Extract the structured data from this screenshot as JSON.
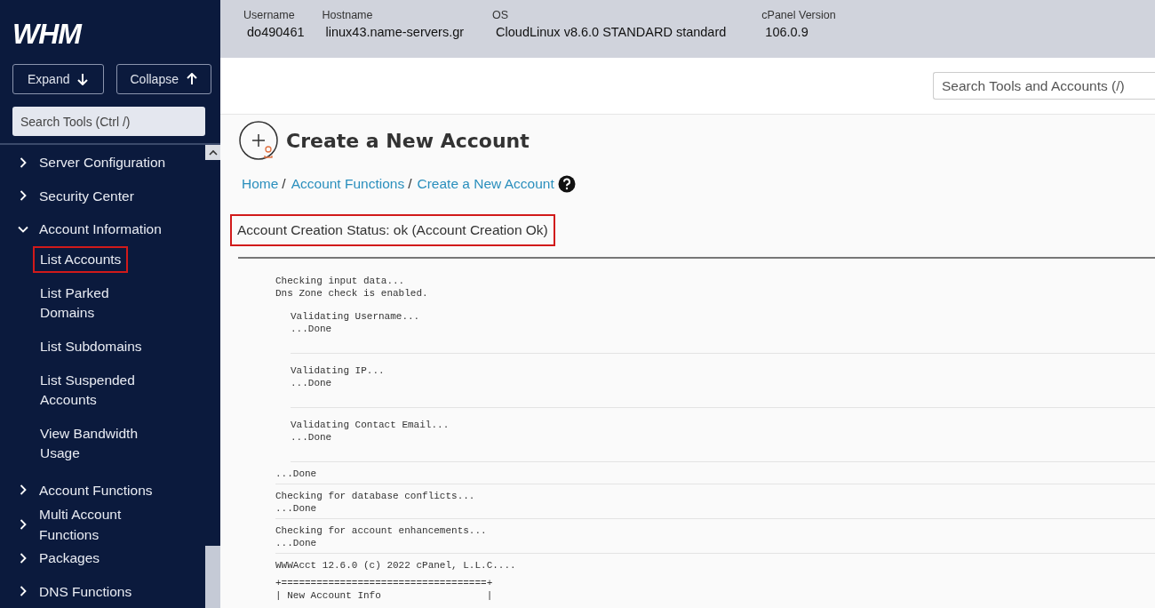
{
  "sidebar": {
    "logo": "WHM",
    "buttons": [
      {
        "label": "Expand",
        "kind": "down"
      },
      {
        "label": "Collapse",
        "kind": "up"
      }
    ],
    "search": {
      "placeholder": "Search Tools (Ctrl /)"
    },
    "items": [
      {
        "label": "Server Configuration",
        "expanded": false
      },
      {
        "label": "Security Center",
        "expanded": false
      },
      {
        "label": "Account Information",
        "expanded": true,
        "children": [
          {
            "label": "List Accounts",
            "highlighted": true
          },
          {
            "label": "List Parked Domains",
            "highlighted": false
          },
          {
            "label": "List Subdomains",
            "highlighted": false
          },
          {
            "label": "List Suspended Accounts",
            "highlighted": false
          },
          {
            "label": "View Bandwidth Usage",
            "highlighted": false
          }
        ]
      },
      {
        "label": "Account Functions",
        "expanded": false
      },
      {
        "label": "Multi Account Functions",
        "expanded": false
      },
      {
        "label": "Packages",
        "expanded": false
      },
      {
        "label": "DNS Functions",
        "expanded": false
      }
    ]
  },
  "server_info": [
    {
      "label": "Username",
      "value": "do490461"
    },
    {
      "label": "Hostname",
      "value": "linux43.name-servers.gr"
    },
    {
      "label": "OS",
      "value": "CloudLinux v8.6.0 STANDARD standard"
    },
    {
      "label": "cPanel Version",
      "value": "106.0.9"
    }
  ],
  "top_search": {
    "placeholder": "Search Tools and Accounts (/)"
  },
  "page": {
    "title": "Create a New Account",
    "breadcrumbs": [
      "Home",
      "Account Functions",
      "Create a New Account"
    ],
    "breadcrumb_separator": "/",
    "status": {
      "text": "Account Creation Status: ok (Account Creation Ok)",
      "highlighted": true
    }
  },
  "log": [
    {
      "kind": "header",
      "lines": [
        "Checking input data...",
        "Dns Zone check is enabled."
      ]
    },
    {
      "kind": "substep",
      "lines": [
        "Validating Username...",
        "...Done"
      ]
    },
    {
      "kind": "substep",
      "lines": [
        "Validating IP...",
        "...Done"
      ]
    },
    {
      "kind": "substep",
      "lines": [
        "Validating Contact Email...",
        "...Done"
      ]
    },
    {
      "kind": "step",
      "lines": [
        "...Done"
      ]
    },
    {
      "kind": "step",
      "lines": [
        "Checking for database conflicts...",
        "...Done"
      ]
    },
    {
      "kind": "step",
      "lines": [
        "Checking for account enhancements...",
        "...Done"
      ]
    },
    {
      "kind": "info",
      "lines": [
        "WWWAcct 12.6.0 (c) 2022 cPanel, L.L.C...."
      ]
    },
    {
      "kind": "info",
      "lines": [
        "+===================================+",
        "| New Account Info                  |"
      ]
    }
  ]
}
